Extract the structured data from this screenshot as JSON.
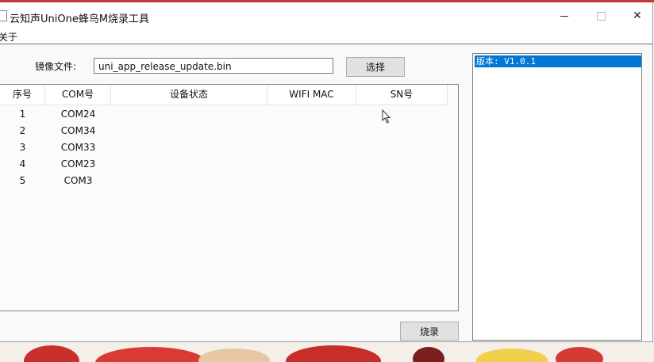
{
  "window": {
    "title": "云知声UniOne蜂鸟M烧录工具",
    "minimize_glyph": "",
    "close_glyph": "✕"
  },
  "menu": {
    "items": [
      {
        "label": "关于"
      }
    ]
  },
  "file": {
    "label": "镜像文件:",
    "value": "uni_app_release_update.bin",
    "choose_label": "选择"
  },
  "table": {
    "columns": [
      "序号",
      "COM号",
      "设备状态",
      "WIFI MAC",
      "SN号"
    ],
    "rows": [
      {
        "index": "1",
        "com": "COM24",
        "status": "",
        "mac": "",
        "sn": ""
      },
      {
        "index": "2",
        "com": "COM34",
        "status": "",
        "mac": "",
        "sn": ""
      },
      {
        "index": "3",
        "com": "COM33",
        "status": "",
        "mac": "",
        "sn": ""
      },
      {
        "index": "4",
        "com": "COM23",
        "status": "",
        "mac": "",
        "sn": ""
      },
      {
        "index": "5",
        "com": "COM3",
        "status": "",
        "mac": "",
        "sn": ""
      }
    ]
  },
  "actions": {
    "burn_label": "烧录"
  },
  "version_list": {
    "items": [
      "版本: V1.0.1"
    ],
    "selected_color": "#0078d7"
  }
}
